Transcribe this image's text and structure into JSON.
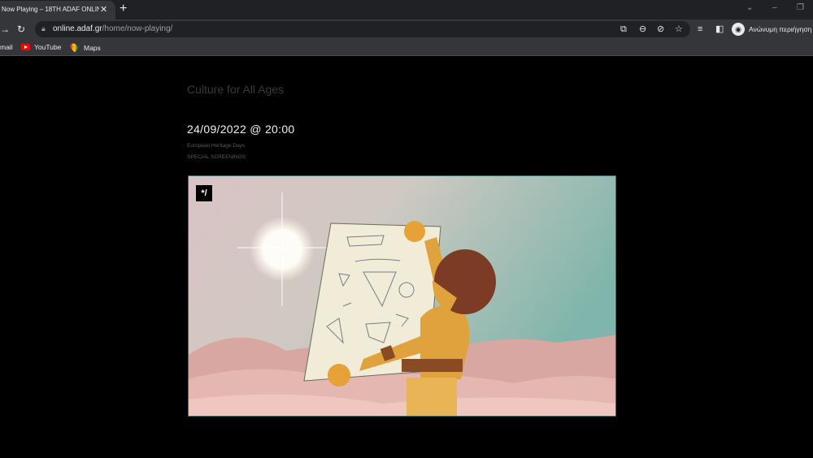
{
  "browser": {
    "tab_title": "Now Playing – 18TH ADAF ONLINE",
    "tab_close": "✕",
    "new_tab": "+",
    "url_host": "online.adaf.gr",
    "url_path": "/home/now-playing/",
    "profile_label": "Ανώνυμη περιήγηση",
    "bookmarks": [
      "mail",
      "YouTube",
      "Maps"
    ]
  },
  "page": {
    "section_title": "Culture for All Ages",
    "datetime": "24/09/2022 @ 20:00",
    "event_category": "European Heritage Days",
    "event_type": "SPECIAL SCREENINGS",
    "video_badge": "*/"
  },
  "colors": {
    "page_bg": "#000000",
    "chrome_bg": "#35363a",
    "titlebar_bg": "#202124"
  }
}
